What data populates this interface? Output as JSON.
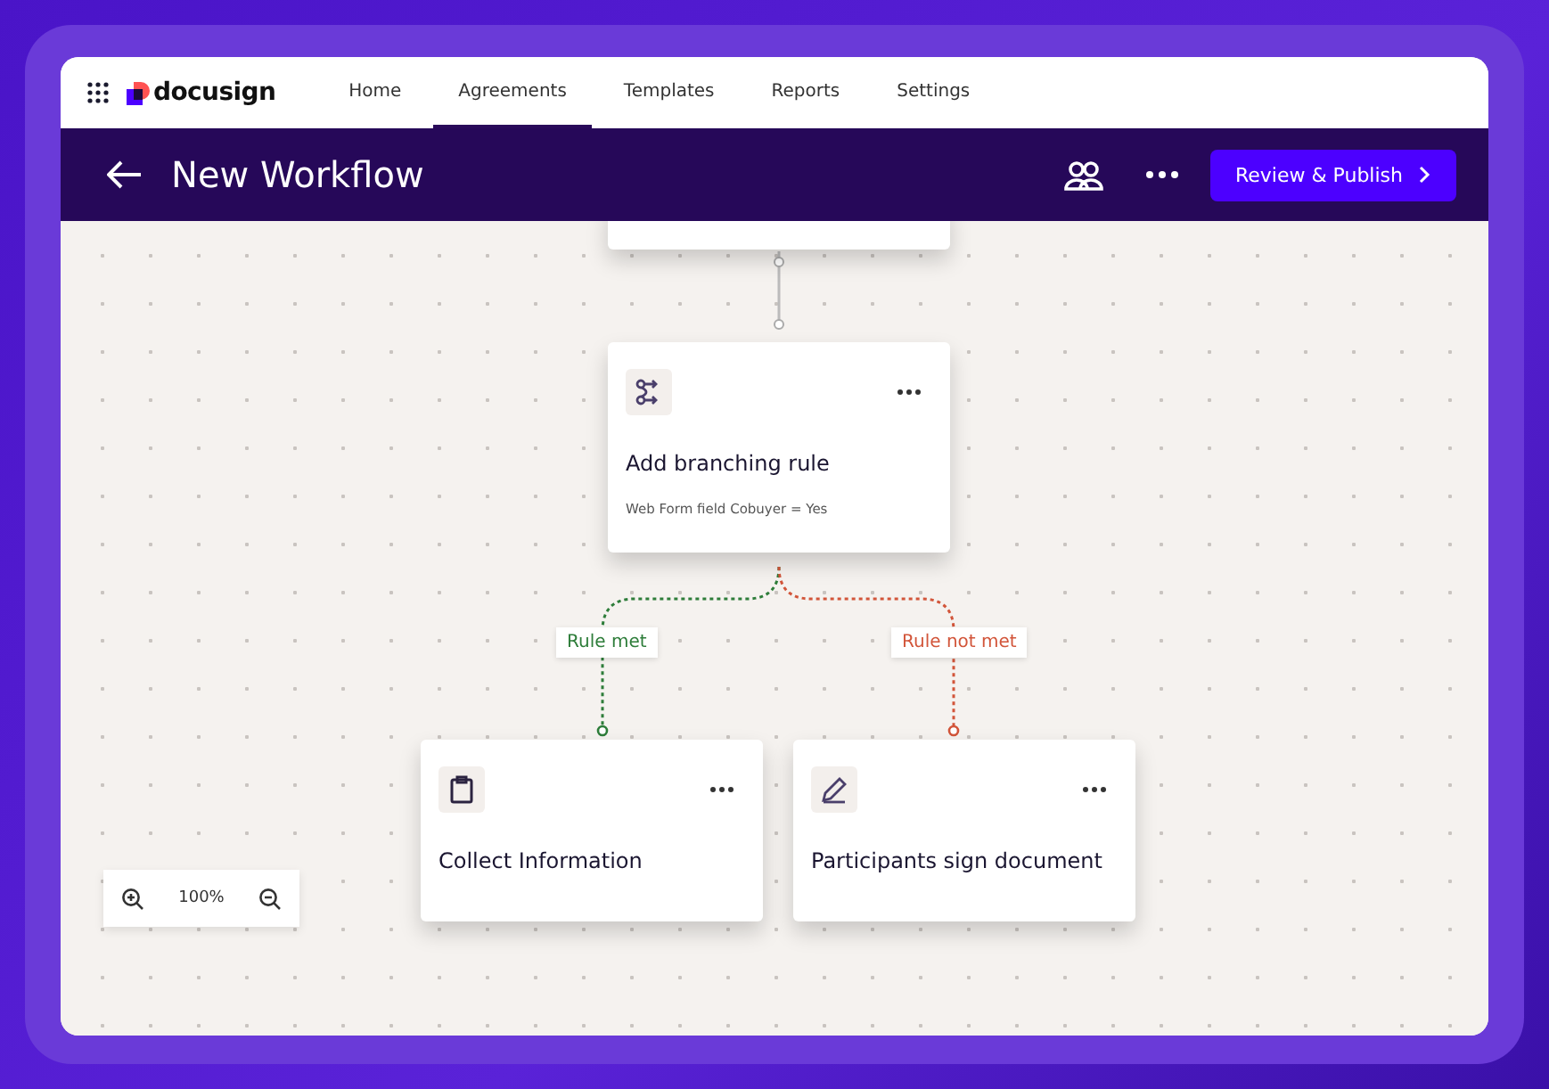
{
  "brand": {
    "name": "docusign"
  },
  "nav": [
    {
      "label": "Home",
      "selected": false
    },
    {
      "label": "Agreements",
      "selected": true
    },
    {
      "label": "Templates",
      "selected": false
    },
    {
      "label": "Reports",
      "selected": false
    },
    {
      "label": "Settings",
      "selected": false
    }
  ],
  "header": {
    "title": "New Workflow",
    "primary_button": "Review & Publish"
  },
  "nodes": [
    {
      "kind": "branch",
      "title": "Add branching rule",
      "subtitle": "Web Form field  Cobuyer = Yes"
    },
    {
      "kind": "form",
      "title": "Collect Information"
    },
    {
      "kind": "sign",
      "title": "Participants sign document"
    }
  ],
  "branches": [
    {
      "label": "Rule met",
      "color": "#2e7d3a"
    },
    {
      "label": "Rule not met",
      "color": "#d2553a"
    }
  ],
  "zoom": {
    "value": "100%"
  }
}
